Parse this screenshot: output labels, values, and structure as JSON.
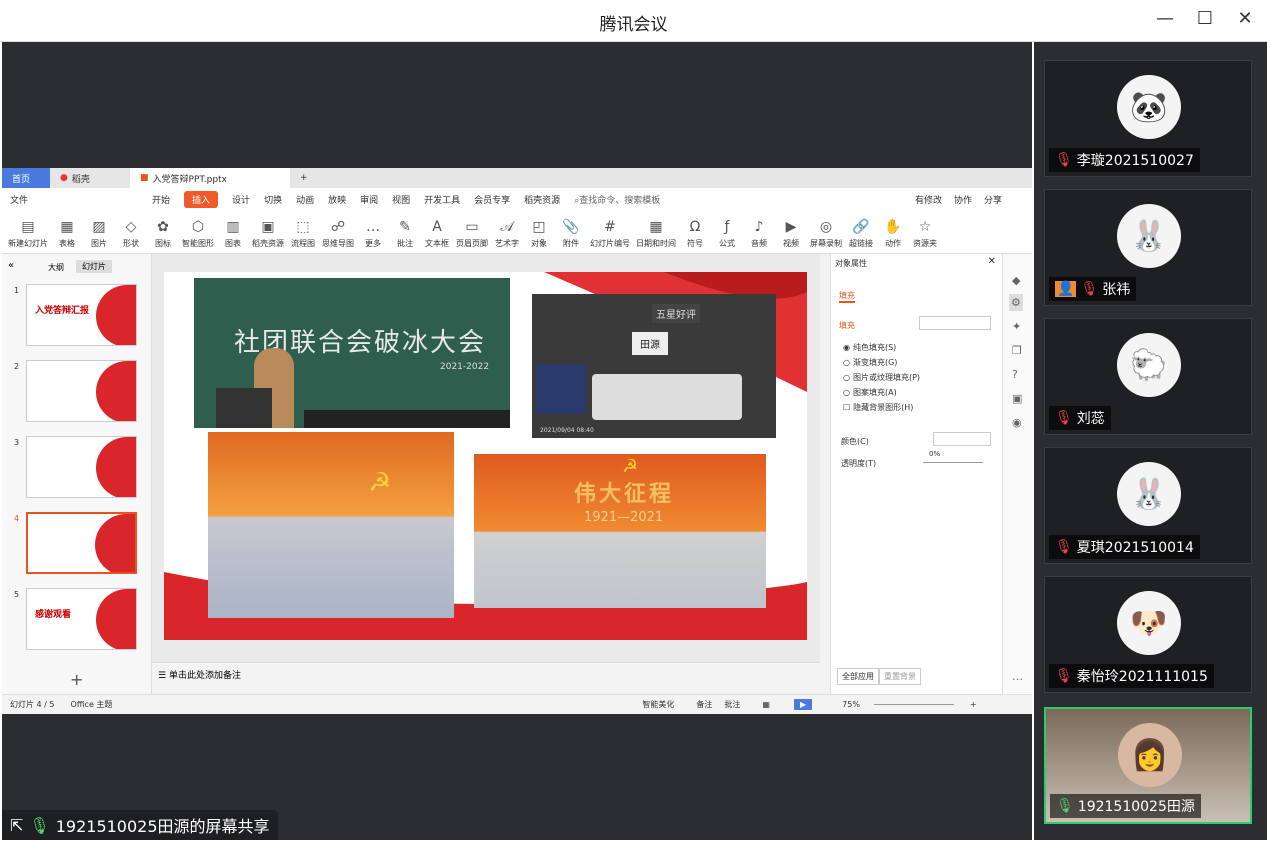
{
  "window": {
    "title": "腾讯会议"
  },
  "share": {
    "label": "1921510025田源的屏幕共享"
  },
  "participants": [
    {
      "name": "李璇2021510027",
      "avatar": "🐼"
    },
    {
      "name": "张祎",
      "avatar": "🐰"
    },
    {
      "name": "刘蕊",
      "avatar": "🐑"
    },
    {
      "name": "夏琪2021510014",
      "avatar": "🐰"
    },
    {
      "name": "秦怡玲2021111015",
      "avatar": "🐶"
    },
    {
      "name": "1921510025田源",
      "avatar": "👩"
    }
  ],
  "ppt": {
    "tabs": [
      "首页",
      "稻壳",
      "入党答辩PPT.pptx"
    ],
    "menu": [
      "文件",
      "开始",
      "插入",
      "设计",
      "切换",
      "动画",
      "放映",
      "审阅",
      "视图",
      "开发工具",
      "会员专享",
      "稻壳资源"
    ],
    "search": "查找命令、搜索模板",
    "top_right": [
      "有修改",
      "协作",
      "分享"
    ],
    "ribbon": [
      "新建幻灯片",
      "表格",
      "图片",
      "形状",
      "图标",
      "智能图形",
      "图表",
      "稻壳资源",
      "流程图",
      "思维导图",
      "更多",
      "批注",
      "文本框",
      "页眉页脚",
      "艺术字",
      "对象",
      "附件",
      "幻灯片编号",
      "日期和时间",
      "符号",
      "公式",
      "音频",
      "视频",
      "屏幕录制",
      "超链接",
      "动作",
      "资源夹"
    ],
    "panel_tabs": [
      "大纲",
      "幻灯片"
    ],
    "thumbs": [
      {
        "num": "1",
        "title": "入党答辩汇报"
      },
      {
        "num": "2",
        "title": ""
      },
      {
        "num": "3",
        "title": ""
      },
      {
        "num": "4",
        "title": ""
      },
      {
        "num": "5",
        "title": "感谢观看"
      }
    ],
    "slide": {
      "board_text": "社团联合会破冰大会",
      "board_date": "2021-2022",
      "stamp": "2021/09/04 08:40",
      "banner": "伟大征程",
      "banner_years": "1921—2021",
      "desk_sign": "田源",
      "desk_sign2": "五星好评"
    },
    "notes": "单击此处添加备注",
    "props": {
      "title": "对象属性",
      "tab": "填充",
      "section": "填充",
      "options": [
        "纯色填充(S)",
        "渐变填充(G)",
        "图片或纹理填充(P)",
        "图案填充(A)",
        "隐藏背景图形(H)"
      ],
      "color_label": "颜色(C)",
      "transparency_label": "透明度(T)",
      "transparency": "0%",
      "apply_all": "全部应用",
      "reset_bg": "重置背景"
    },
    "status": {
      "slide": "幻灯片 4 / 5",
      "theme": "Office 主题",
      "beautify": "智能美化",
      "notes": "备注",
      "comment": "批注",
      "zoom": "75%"
    }
  }
}
